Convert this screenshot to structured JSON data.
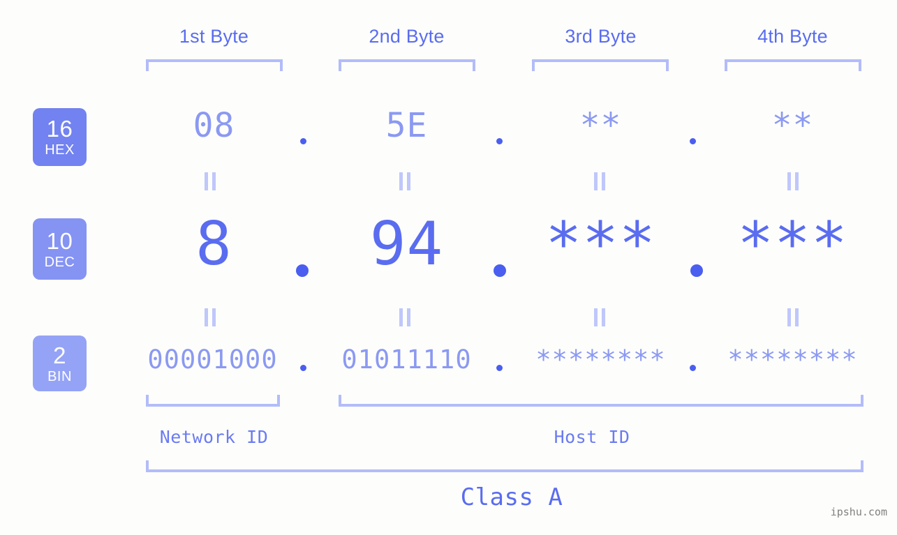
{
  "meta": {
    "watermark": "ipshu.com"
  },
  "byte_headers": [
    {
      "label": "1st Byte"
    },
    {
      "label": "2nd Byte"
    },
    {
      "label": "3rd Byte"
    },
    {
      "label": "4th Byte"
    }
  ],
  "bases": [
    {
      "num": "16",
      "name": "HEX",
      "color": "#7282f0"
    },
    {
      "num": "10",
      "name": "DEC",
      "color": "#8593f3"
    },
    {
      "num": "2",
      "name": "BIN",
      "color": "#95a3f6"
    }
  ],
  "rows": {
    "hex": {
      "base_num": "16",
      "base_name": "HEX",
      "values": [
        "08",
        "5E",
        "**",
        "**"
      ],
      "separators": [
        ".",
        ".",
        "."
      ]
    },
    "dec": {
      "base_num": "10",
      "base_name": "DEC",
      "values": [
        "8",
        "94",
        "***",
        "***"
      ],
      "separators": [
        ".",
        ".",
        "."
      ]
    },
    "bin": {
      "base_num": "2",
      "base_name": "BIN",
      "values": [
        "00001000",
        "01011110",
        "********",
        "********"
      ],
      "separators": [
        ".",
        ".",
        "."
      ]
    }
  },
  "equals_glyph": "=",
  "sections": {
    "network_id": "Network ID",
    "host_id": "Host ID",
    "class": "Class A"
  },
  "colors": {
    "background": "#fdfefb",
    "accent": "#5a6cf0",
    "accent_light": "#8b99f2",
    "bracket": "#b3bcfa",
    "dot": "#4a5ef0",
    "equals": "#bfc7fb",
    "watermark": "#808080"
  }
}
